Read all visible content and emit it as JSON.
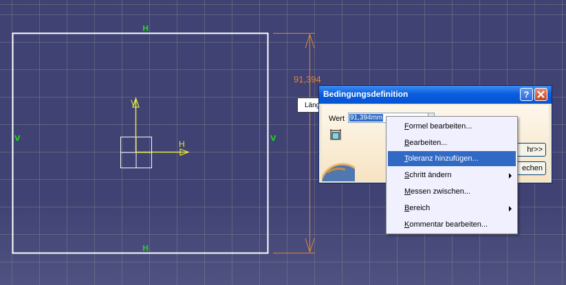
{
  "viewport": {
    "constraint_labels": {
      "top": "H",
      "bottom": "H",
      "left": "V",
      "right": "V"
    },
    "dimension_value": "91,394",
    "axis_h_label": "H",
    "axis_v_label": "V",
    "tooltip_text": "Läng",
    "colors": {
      "background": "#3f4273",
      "sketch": "#ffffff",
      "constraint": "#1ed11e",
      "dimension": "#e8842e",
      "axis": "#e6e640"
    }
  },
  "dialog": {
    "title": "Bedingungsdefinition",
    "help_icon": "question-mark-icon",
    "close_icon": "close-x-icon",
    "wert_label": "Wert",
    "wert_value": "91,394mm",
    "more_button": "hr>>",
    "cancel_button": "echen"
  },
  "context_menu": {
    "items": [
      {
        "label": "Formel bearbeiten...",
        "accel": "F",
        "rest": "ormel bearbeiten...",
        "submenu": false,
        "highlighted": false
      },
      {
        "label": "Bearbeiten...",
        "accel": "B",
        "rest": "earbeiten...",
        "submenu": false,
        "highlighted": false
      },
      {
        "label": "Toleranz hinzufügen...",
        "accel": "T",
        "rest": "oleranz hinzufügen...",
        "submenu": false,
        "highlighted": true
      },
      {
        "label": "Schritt ändern",
        "accel": "S",
        "rest": "chritt ändern",
        "submenu": true,
        "highlighted": false
      },
      {
        "label": "Messen zwischen...",
        "accel": "M",
        "rest": "essen zwischen...",
        "submenu": false,
        "highlighted": false
      },
      {
        "label": "Bereich",
        "accel": "B",
        "rest": "ereich",
        "submenu": true,
        "highlighted": false
      },
      {
        "label": "Kommentar bearbeiten...",
        "accel": "K",
        "rest": "ommentar bearbeiten...",
        "submenu": false,
        "highlighted": false
      }
    ]
  }
}
